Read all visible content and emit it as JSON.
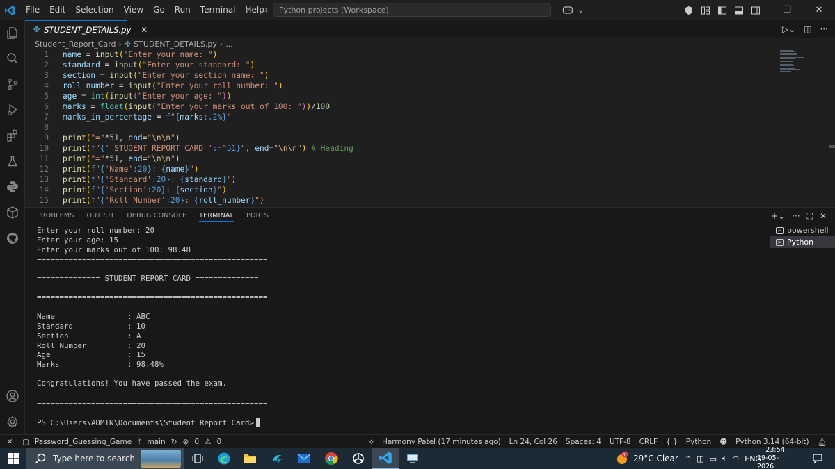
{
  "titlebar": {
    "menu": [
      "File",
      "Edit",
      "Selection",
      "View",
      "Go",
      "Run",
      "Terminal",
      "Help"
    ],
    "command_center": "Python projects (Workspace)"
  },
  "tab": {
    "filename": "STUDENT_DETAILS.py"
  },
  "breadcrumb": {
    "folder": "Student_Report_Card",
    "file": "STUDENT_DETAILS.py",
    "more": "..."
  },
  "editor": {
    "line_numbers": [
      "1",
      "2",
      "3",
      "4",
      "5",
      "6",
      "7",
      "8",
      "9",
      "10",
      "11",
      "12",
      "13",
      "14",
      "15"
    ]
  },
  "panel": {
    "tabs": [
      "PROBLEMS",
      "OUTPUT",
      "DEBUG CONSOLE",
      "TERMINAL",
      "PORTS"
    ],
    "terminal_lines": [
      "Enter your roll number: 20",
      "Enter your age: 15",
      "Enter your marks out of 100: 98.48",
      "===================================================",
      "",
      "============== STUDENT REPORT CARD ==============",
      "",
      "===================================================",
      "",
      "Name                : ABC",
      "Standard            : 10",
      "Section             : A",
      "Roll Number         : 20",
      "Age                 : 15",
      "Marks               : 98.48%",
      "",
      "Congratulations! You have passed the exam.",
      "",
      "===================================================",
      "",
      "PS C:\\Users\\ADMIN\\Documents\\Student_Report_Card>"
    ],
    "terminals": [
      "powershell",
      "Python"
    ]
  },
  "statusbar": {
    "branch_folder": "Password_Guessing_Game",
    "branch": "main",
    "errors": "0",
    "warnings": "0",
    "blame": "Harmony Patel (17 minutes ago)",
    "position": "Ln 24, Col 26",
    "spaces": "Spaces: 4",
    "encoding": "UTF-8",
    "eol": "CRLF",
    "language": "Python",
    "interpreter": "Python 3.14 (64-bit)"
  },
  "taskbar": {
    "search_placeholder": "Type here to search",
    "weather": "29°C  Clear",
    "weather_badge": "1",
    "language": "ENG",
    "time": "23:54",
    "date": "19-05-2026"
  },
  "colors": {
    "accent": "#0078d4",
    "editor_bg": "#1f1f1f",
    "panel_bg": "#181818",
    "taskbar_bg": "#1c2a35"
  }
}
